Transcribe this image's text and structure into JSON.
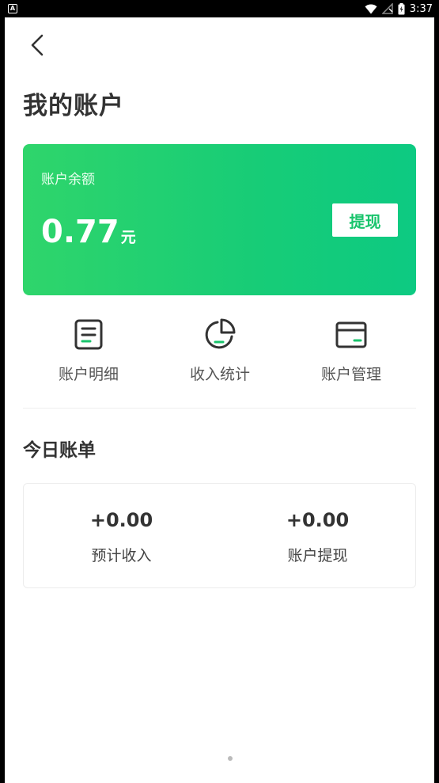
{
  "status_bar": {
    "time": "3:37",
    "notification_icon_label": "A"
  },
  "page": {
    "title": "我的账户"
  },
  "balance": {
    "label": "账户余额",
    "value": "0.77",
    "unit": "元",
    "withdraw_label": "提现"
  },
  "quick_actions": [
    {
      "label": "账户明细",
      "icon": "document-list-icon"
    },
    {
      "label": "收入统计",
      "icon": "pie-chart-icon"
    },
    {
      "label": "账户管理",
      "icon": "card-icon"
    }
  ],
  "today_bill": {
    "title": "今日账单",
    "items": [
      {
        "value": "+0.00",
        "label": "预计收入"
      },
      {
        "value": "+0.00",
        "label": "账户提现"
      }
    ]
  },
  "colors": {
    "accent": "#19c46c",
    "card_gradient_start": "#2fd56b",
    "card_gradient_end": "#0dca82"
  }
}
